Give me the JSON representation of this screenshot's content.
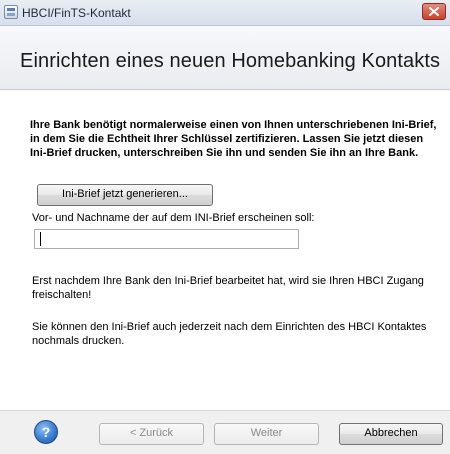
{
  "window": {
    "title": "HBCI/FinTS-Kontakt"
  },
  "header": {
    "title": "Einrichten eines neuen Homebanking Kontakts"
  },
  "content": {
    "intro": "Ihre Bank benötigt normalerweise einen von Ihnen unterschriebenen Ini-Brief, in dem Sie die Echtheit Ihrer Schlüssel zertifizieren. Lassen Sie jetzt diesen Ini-Brief drucken, unterschreiben Sie ihn und senden Sie ihn an Ihre Bank.",
    "generate_button": "Ini-Brief jetzt generieren...",
    "name_label": "Vor- und Nachname der auf dem INI-Brief erscheinen soll:",
    "name_value": "",
    "para1": "Erst nachdem Ihre Bank den Ini-Brief bearbeitet hat, wird sie Ihren HBCI Zugang freischalten!",
    "para2": "Sie können den Ini-Brief auch jederzeit nach dem Einrichten des HBCI Kontaktes nochmals drucken."
  },
  "footer": {
    "help_symbol": "?",
    "back_button": "< Zurück",
    "next_button": "Weiter",
    "cancel_button": "Abbrechen"
  },
  "icons": {
    "app": "app-window-icon",
    "close": "close-icon",
    "help": "help-icon"
  },
  "colors": {
    "close_button": "#c8432f",
    "help_icon": "#3b7fd1",
    "header_band": "#eef0f3",
    "footer": "#f0f0f0"
  }
}
